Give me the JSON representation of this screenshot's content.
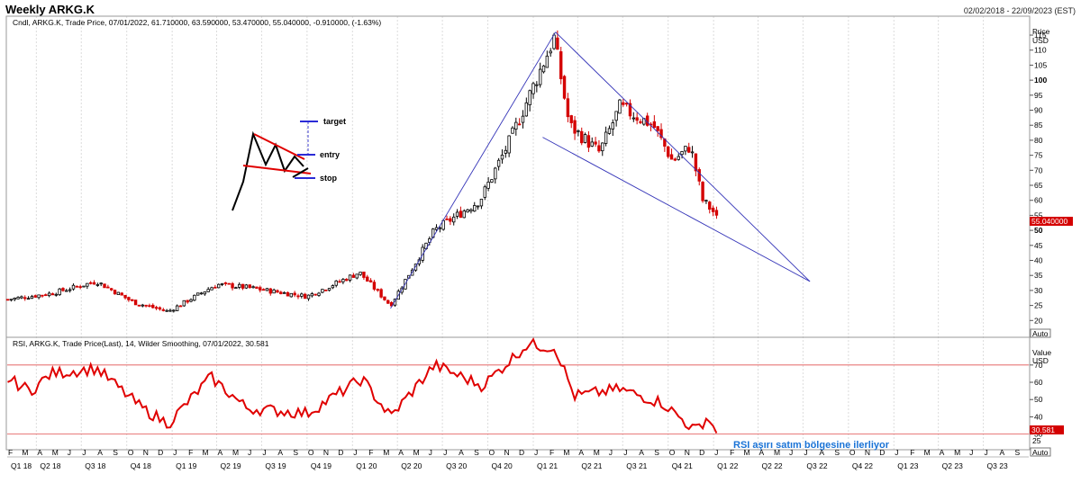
{
  "header": {
    "title": "Weekly ARKG.K",
    "date_range": "02/02/2018 - 22/09/2023 (EST)"
  },
  "chart_data": [
    {
      "type": "candlestick",
      "legend": "Cndl, ARKG.K, Trade Price, 07/01/2022, 61.710000, 63.590000, 53.470000, 55.040000, -0.910000, (-1.63%)",
      "ylabel": "Price",
      "yunit": "USD",
      "ylim": [
        15,
        121
      ],
      "y_ticks": [
        20,
        25,
        30,
        35,
        40,
        45,
        50,
        55,
        60,
        65,
        70,
        75,
        80,
        85,
        90,
        95,
        100,
        105,
        110,
        115
      ],
      "y_ticks_bold": [
        50,
        100
      ],
      "last_price_label": "55.040000",
      "last_price": 55.04,
      "auto_label": "Auto",
      "color_up": "#000000",
      "color_down": "#d40000",
      "key_closes": [
        {
          "x": "2018-02-02",
          "close": 27
        },
        {
          "x": "2018-05-01",
          "close": 29
        },
        {
          "x": "2018-08-01",
          "close": 33
        },
        {
          "x": "2018-10-15",
          "close": 26
        },
        {
          "x": "2018-12-24",
          "close": 23
        },
        {
          "x": "2019-04-01",
          "close": 32
        },
        {
          "x": "2019-06-01",
          "close": 31
        },
        {
          "x": "2019-10-01",
          "close": 28
        },
        {
          "x": "2020-01-15",
          "close": 36
        },
        {
          "x": "2020-03-18",
          "close": 25
        },
        {
          "x": "2020-06-15",
          "close": 50
        },
        {
          "x": "2020-09-15",
          "close": 60
        },
        {
          "x": "2020-11-15",
          "close": 80
        },
        {
          "x": "2021-02-12",
          "close": 114
        },
        {
          "x": "2021-03-15",
          "close": 85
        },
        {
          "x": "2021-05-15",
          "close": 76
        },
        {
          "x": "2021-06-25",
          "close": 91
        },
        {
          "x": "2021-09-01",
          "close": 85
        },
        {
          "x": "2021-10-10",
          "close": 73
        },
        {
          "x": "2021-11-15",
          "close": 78
        },
        {
          "x": "2021-12-10",
          "close": 60
        },
        {
          "x": "2022-01-07",
          "close": 55.04
        }
      ],
      "trendlines": [
        {
          "from": {
            "x": "2020-03-18",
            "y": 24
          },
          "to": {
            "x": "2021-02-15",
            "y": 116
          }
        },
        {
          "from": {
            "x": "2021-02-15",
            "y": 116
          },
          "to": {
            "x": "2022-07-15",
            "y": 33
          }
        },
        {
          "from": {
            "x": "2021-01-20",
            "y": 81
          },
          "to": {
            "x": "2022-07-15",
            "y": 33
          }
        }
      ],
      "pattern_legend": {
        "target": "target",
        "entry": "entry",
        "stop": "stop"
      }
    },
    {
      "type": "line",
      "legend": "RSI, ARKG.K, Trade Price(Last),  14, Wilder Smoothing, 07/01/2022, 30.581",
      "ylabel": "Value",
      "yunit": "USD",
      "ylim": [
        22,
        85
      ],
      "y_ticks": [
        30,
        40,
        50,
        60,
        70
      ],
      "levels": [
        70,
        30
      ],
      "last_value_label": "30.581",
      "last_value": 30.581,
      "tail_label": "25",
      "auto_label": "Auto",
      "color": "#e00000",
      "annotation": "RSI aşırı satım bölgesine ilerliyor",
      "key_values": [
        {
          "x": "2018-02-02",
          "v": 62
        },
        {
          "x": "2018-03-20",
          "v": 55
        },
        {
          "x": "2018-05-01",
          "v": 65
        },
        {
          "x": "2018-08-01",
          "v": 68
        },
        {
          "x": "2018-11-01",
          "v": 45
        },
        {
          "x": "2018-12-24",
          "v": 36
        },
        {
          "x": "2019-03-20",
          "v": 63
        },
        {
          "x": "2019-06-01",
          "v": 45
        },
        {
          "x": "2019-10-01",
          "v": 42
        },
        {
          "x": "2020-01-20",
          "v": 62
        },
        {
          "x": "2020-03-18",
          "v": 40
        },
        {
          "x": "2020-06-15",
          "v": 70
        },
        {
          "x": "2020-09-20",
          "v": 58
        },
        {
          "x": "2020-12-20",
          "v": 82
        },
        {
          "x": "2021-02-15",
          "v": 80
        },
        {
          "x": "2021-03-25",
          "v": 52
        },
        {
          "x": "2021-06-25",
          "v": 56
        },
        {
          "x": "2021-09-20",
          "v": 48
        },
        {
          "x": "2021-11-25",
          "v": 32
        },
        {
          "x": "2021-12-20",
          "v": 40
        },
        {
          "x": "2022-01-07",
          "v": 30.581
        }
      ]
    }
  ],
  "time_axis": {
    "months": [
      "F",
      "M",
      "A",
      "M",
      "J",
      "J",
      "A",
      "S",
      "O",
      "N",
      "D",
      "J",
      "F",
      "M",
      "A",
      "M",
      "J",
      "J",
      "A",
      "S",
      "O",
      "N",
      "D",
      "J",
      "F",
      "M",
      "A",
      "M",
      "J",
      "J",
      "A",
      "S",
      "O",
      "N",
      "D",
      "J",
      "F",
      "M",
      "A",
      "M",
      "J",
      "J",
      "A",
      "S",
      "O",
      "N",
      "D",
      "J",
      "F",
      "M",
      "A",
      "M",
      "J",
      "J",
      "A",
      "S",
      "O",
      "N",
      "D",
      "J",
      "F",
      "M",
      "A",
      "M",
      "J",
      "J",
      "A",
      "S"
    ],
    "quarters": [
      "Q1 18",
      "Q2 18",
      "Q3 18",
      "Q4 18",
      "Q1 19",
      "Q2 19",
      "Q3 19",
      "Q4 19",
      "Q1 20",
      "Q2 20",
      "Q3 20",
      "Q4 20",
      "Q1 21",
      "Q2 21",
      "Q3 21",
      "Q4 21",
      "Q1 22",
      "Q2 22",
      "Q3 22",
      "Q4 22",
      "Q1 23",
      "Q2 23",
      "Q3 23"
    ]
  }
}
